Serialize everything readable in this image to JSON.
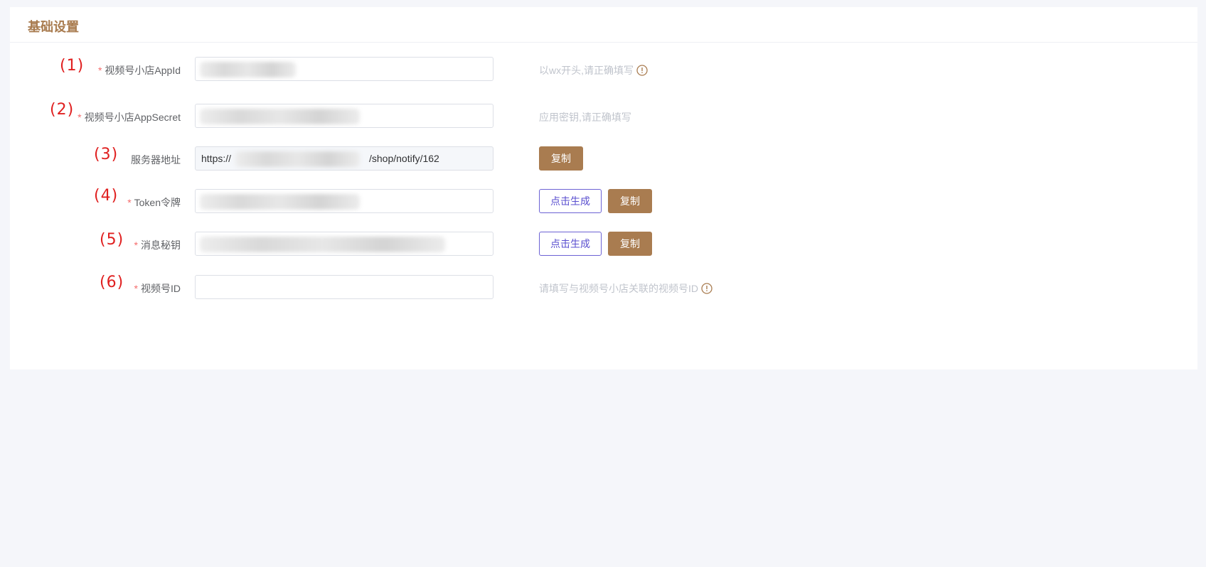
{
  "card": {
    "title": "基础设置"
  },
  "fields": [
    {
      "anno": "(1)",
      "label": "视频号小店AppId",
      "required": true,
      "value": "",
      "hint": "以wx开头,请正确填写"
    },
    {
      "anno": "(2)",
      "label": "视频号小店AppSecret",
      "required": true,
      "value": "",
      "hint": "应用密钥,请正确填写"
    },
    {
      "anno": "(3)",
      "label": "服务器地址",
      "required": false,
      "value_prefix": "https://",
      "value_suffix": "/shop/notify/162",
      "copy_label": "复制"
    },
    {
      "anno": "(4)",
      "label": "Token令牌",
      "required": true,
      "value": "",
      "generate_label": "点击生成",
      "copy_label": "复制"
    },
    {
      "anno": "(5)",
      "label": "消息秘钥",
      "required": true,
      "value": "",
      "generate_label": "点击生成",
      "copy_label": "复制"
    },
    {
      "anno": "(6)",
      "label": "视频号ID",
      "required": true,
      "value": "",
      "placeholder": "",
      "hint": "请填写与视频号小店关联的视频号ID"
    }
  ],
  "required_mark": "*",
  "colors": {
    "accent": "#a97c50",
    "outline": "#6c62d4",
    "required": "#f56c6c",
    "annotation": "#e02020"
  },
  "icons": {
    "hint": "info-circle-icon"
  }
}
